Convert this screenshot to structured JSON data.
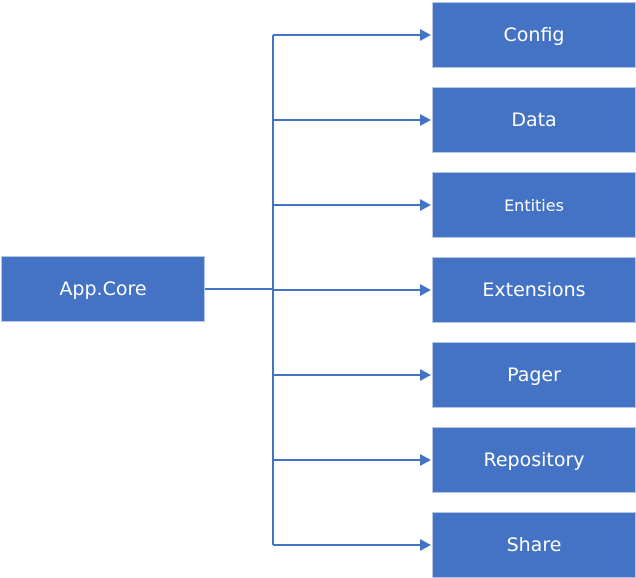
{
  "diagram": {
    "root": {
      "label": "App.Core"
    },
    "children": [
      {
        "label": "Config"
      },
      {
        "label": "Data"
      },
      {
        "label": "Entities"
      },
      {
        "label": "Extensions"
      },
      {
        "label": "Pager"
      },
      {
        "label": "Repository"
      },
      {
        "label": "Share"
      }
    ],
    "colors": {
      "box_fill": "#4472c4",
      "connector": "#4472c4",
      "text": "#ffffff"
    }
  }
}
